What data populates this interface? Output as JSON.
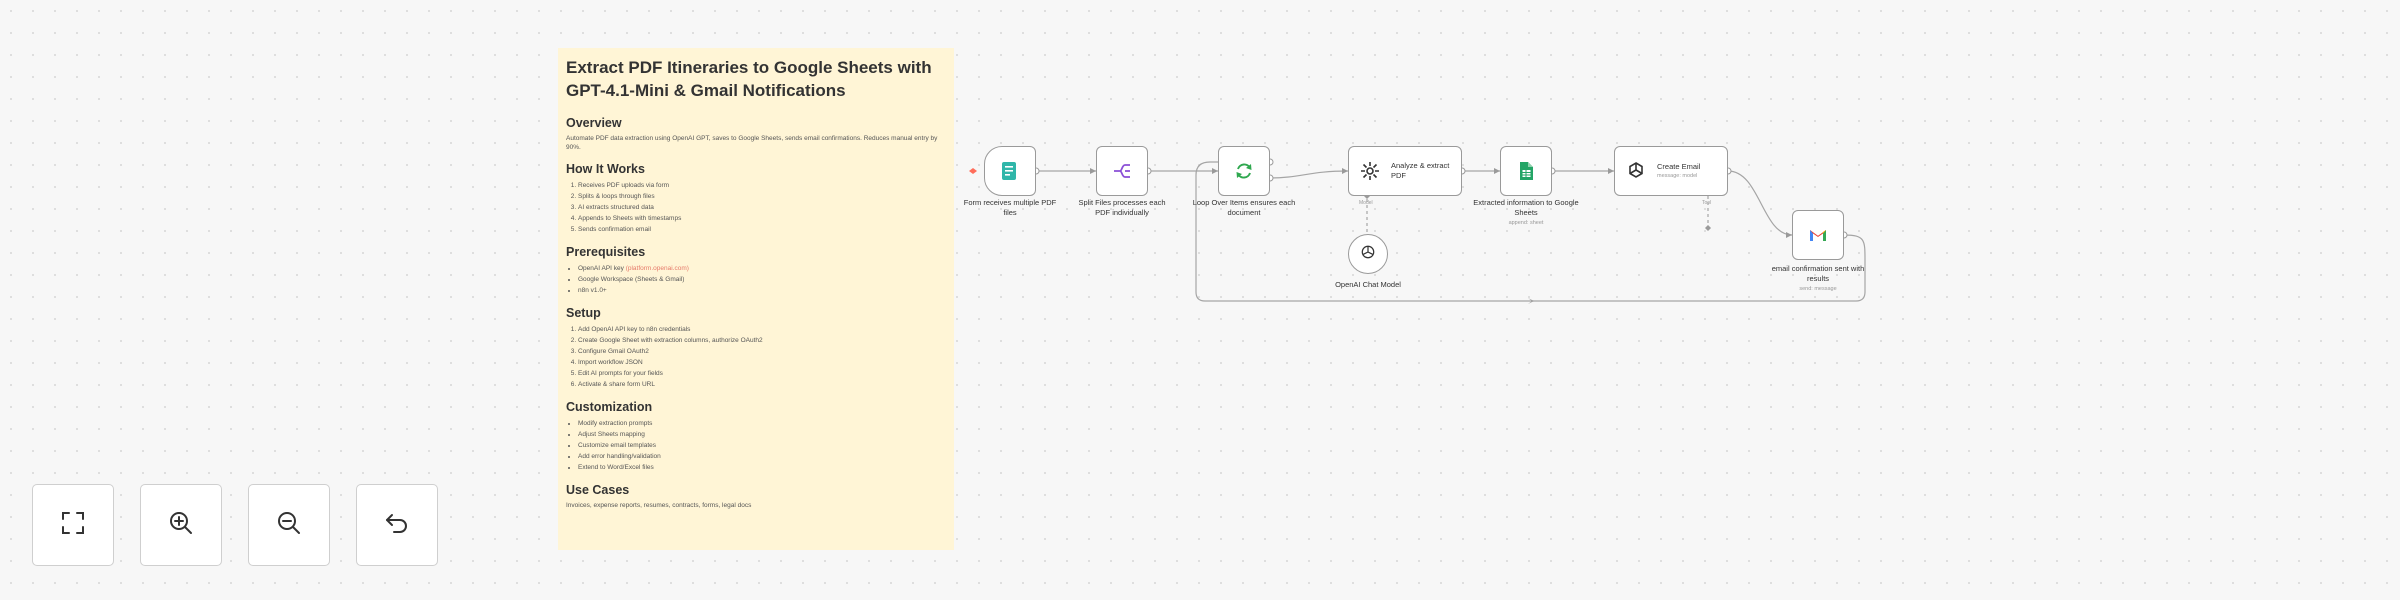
{
  "note": {
    "title": "Extract PDF Itineraries to Google Sheets with GPT-4.1-Mini & Gmail Notifications",
    "overview_heading": "Overview",
    "overview_text": "Automate PDF data extraction using OpenAI GPT, saves to Google Sheets, sends email confirmations. Reduces manual entry by 90%.",
    "how_heading": "How It Works",
    "how_items": [
      "Receives PDF uploads via form",
      "Splits & loops through files",
      "AI extracts structured data",
      "Appends to Sheets with timestamps",
      "Sends confirmation email"
    ],
    "prereq_heading": "Prerequisites",
    "prereq_items": [
      {
        "text": "OpenAI API key ",
        "link": "(platform.openai.com)"
      },
      {
        "text": "Google Workspace (Sheets & Gmail)",
        "link": ""
      },
      {
        "text": "n8n v1.0+",
        "link": ""
      }
    ],
    "setup_heading": "Setup",
    "setup_items": [
      "Add OpenAI API key to n8n credentials",
      "Create Google Sheet with extraction columns, authorize OAuth2",
      "Configure Gmail OAuth2",
      "Import workflow JSON",
      "Edit AI prompts for your fields",
      "Activate & share form URL"
    ],
    "custom_heading": "Customization",
    "custom_items": [
      "Modify extraction prompts",
      "Adjust Sheets mapping",
      "Customize email templates",
      "Add error handling/validation",
      "Extend to Word/Excel files"
    ],
    "use_heading": "Use Cases",
    "use_text": "Invoices, expense reports, resumes, contracts, forms, legal docs"
  },
  "nodes": {
    "form": {
      "caption": "Form receives multiple PDF files",
      "icon": "form-icon"
    },
    "split": {
      "caption": "Split Files processes each PDF individually",
      "icon": "split-out-icon"
    },
    "loop": {
      "caption": "Loop Over Items ensures each document",
      "icon": "loop-icon"
    },
    "analyze": {
      "title": "Analyze & extract PDF",
      "icon": "openai-icon",
      "sub_label": "Model"
    },
    "chat_model": {
      "caption": "OpenAI Chat Model",
      "icon": "openai-icon"
    },
    "sheets": {
      "caption": "Extracted information to Google Sheets",
      "sub": "append: sheet",
      "icon": "google-sheets-icon"
    },
    "email": {
      "title": "Create Email",
      "sub": "message: model",
      "icon": "openai-icon",
      "tool_label": "Tool"
    },
    "gmail": {
      "caption": "email confirmation sent with results",
      "sub": "send: message",
      "icon": "gmail-icon"
    }
  },
  "colors": {
    "note_bg": "#fff5d6",
    "form_icon": "#2fb6a9",
    "split_icon": "#8a4fd6",
    "loop_icon": "#2fa84f",
    "sheets_icon": "#23a566",
    "gmail_red": "#ea4335",
    "gmail_blue": "#4285f4",
    "trigger_marker": "#ff6d5a"
  },
  "controls": [
    {
      "name": "fit-view",
      "icon": "fit-view-icon"
    },
    {
      "name": "zoom-in",
      "icon": "zoom-in-icon"
    },
    {
      "name": "zoom-out",
      "icon": "zoom-out-icon"
    },
    {
      "name": "reset",
      "icon": "undo-icon"
    }
  ]
}
